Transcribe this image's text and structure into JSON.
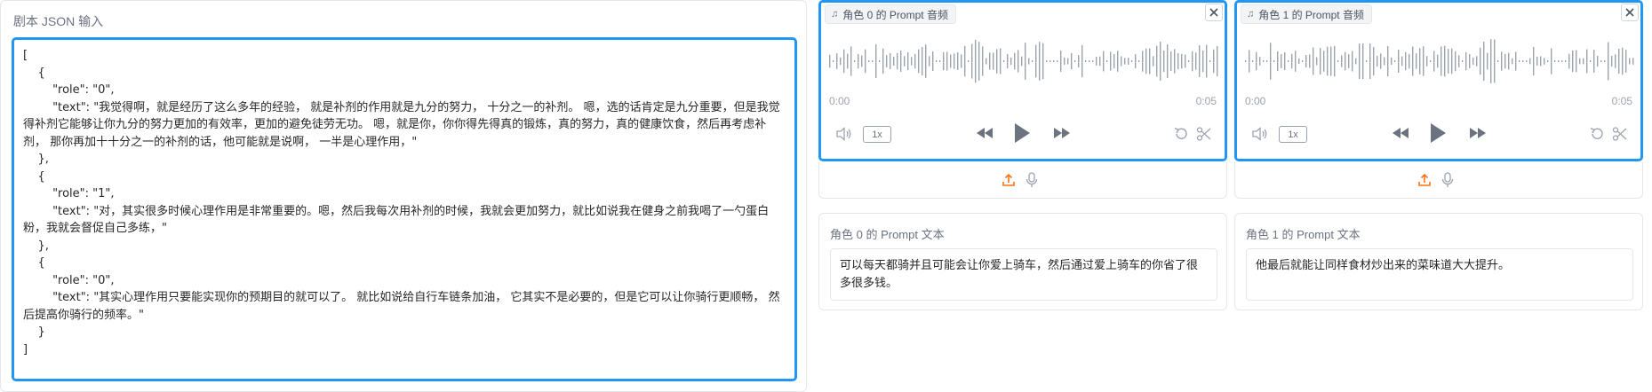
{
  "json_input": {
    "label": "剧本 JSON 输入",
    "value": "[\n    {\n        \"role\": \"0\",\n        \"text\": \"我觉得啊，就是经历了这么多年的经验， 就是补剂的作用就是九分的努力， 十分之一的补剂。 嗯，选的话肯定是九分重要，但是我觉得补剂它能够让你九分的努力更加的有效率，更加的避免徒劳无功。 嗯，就是你，你你得先得真的锻炼，真的努力，真的健康饮食，然后再考虑补剂， 那你再加十十分之一的补剂的话，他可能就是说啊， 一半是心理作用，\"\n    },\n    {\n        \"role\": \"1\",\n        \"text\": \"对，其实很多时候心理作用是非常重要的。嗯，然后我每次用补剂的时候，我就会更加努力，就比如说我在健身之前我喝了一勺蛋白粉，我就会督促自己多练，\"\n    },\n    {\n        \"role\": \"0\",\n        \"text\": \"其实心理作用只要能实现你的预期目的就可以了。 就比如说给自行车链条加油， 它其实不是必要的，但是它可以让你骑行更顺畅， 然后提高你骑行的频率。\"\n    }\n]"
  },
  "audio_panels": [
    {
      "label": "角色 0 的 Prompt 音频",
      "time_start": "0:00",
      "time_end": "0:05",
      "speed": "1x"
    },
    {
      "label": "角色 1 的 Prompt 音频",
      "time_start": "0:00",
      "time_end": "0:05",
      "speed": "1x"
    }
  ],
  "text_panels": [
    {
      "label": "角色 0 的 Prompt 文本",
      "value": "可以每天都骑并且可能会让你爱上骑车，然后通过爱上骑车的你省了很多很多钱。"
    },
    {
      "label": "角色 1 的 Prompt 文本",
      "value": "他最后就能让同样食材炒出来的菜味道大大提升。"
    }
  ],
  "colors": {
    "accent_border": "#2196f3",
    "upload_icon": "#f97316",
    "waveform": "#9ca3af",
    "label_text": "#6b7280"
  },
  "icons": [
    "music-note-icon",
    "close-icon",
    "volume-icon",
    "rewind-icon",
    "play-icon",
    "fast-forward-icon",
    "undo-icon",
    "scissors-icon",
    "upload-icon",
    "microphone-icon"
  ]
}
